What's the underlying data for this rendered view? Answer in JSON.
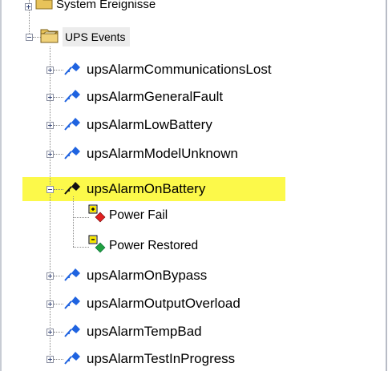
{
  "tree": {
    "partial_top_item": {
      "label": "System Ereignisse",
      "icon": "folder-icon",
      "expanded": false
    },
    "category": {
      "label": "UPS Events",
      "icon": "open-folder-icon",
      "expanded": true,
      "children": [
        {
          "label": "upsAlarmCommunicationsLost",
          "icon": "alarm-trap-icon",
          "expanded": false
        },
        {
          "label": "upsAlarmGeneralFault",
          "icon": "alarm-trap-icon",
          "expanded": false
        },
        {
          "label": "upsAlarmLowBattery",
          "icon": "alarm-trap-icon",
          "expanded": false
        },
        {
          "label": "upsAlarmModelUnknown",
          "icon": "alarm-trap-icon",
          "expanded": false
        },
        {
          "label": "upsAlarmOnBattery",
          "icon": "alarm-trap-icon",
          "expanded": true,
          "highlighted": true,
          "children": [
            {
              "label": "Power Fail",
              "icon": "event-fail-icon",
              "color": "#e02020"
            },
            {
              "label": "Power Restored",
              "icon": "event-restored-icon",
              "color": "#20a040"
            }
          ]
        },
        {
          "label": "upsAlarmOnBypass",
          "icon": "alarm-trap-icon",
          "expanded": false
        },
        {
          "label": "upsAlarmOutputOverload",
          "icon": "alarm-trap-icon",
          "expanded": false
        },
        {
          "label": "upsAlarmTempBad",
          "icon": "alarm-trap-icon",
          "expanded": false
        },
        {
          "label": "upsAlarmTestInProgress",
          "icon": "alarm-trap-icon",
          "expanded": false
        }
      ]
    }
  },
  "colors": {
    "highlight": "#fcf94a",
    "connector": "#8a8a8a",
    "trap_icon": "#1f63e0"
  }
}
